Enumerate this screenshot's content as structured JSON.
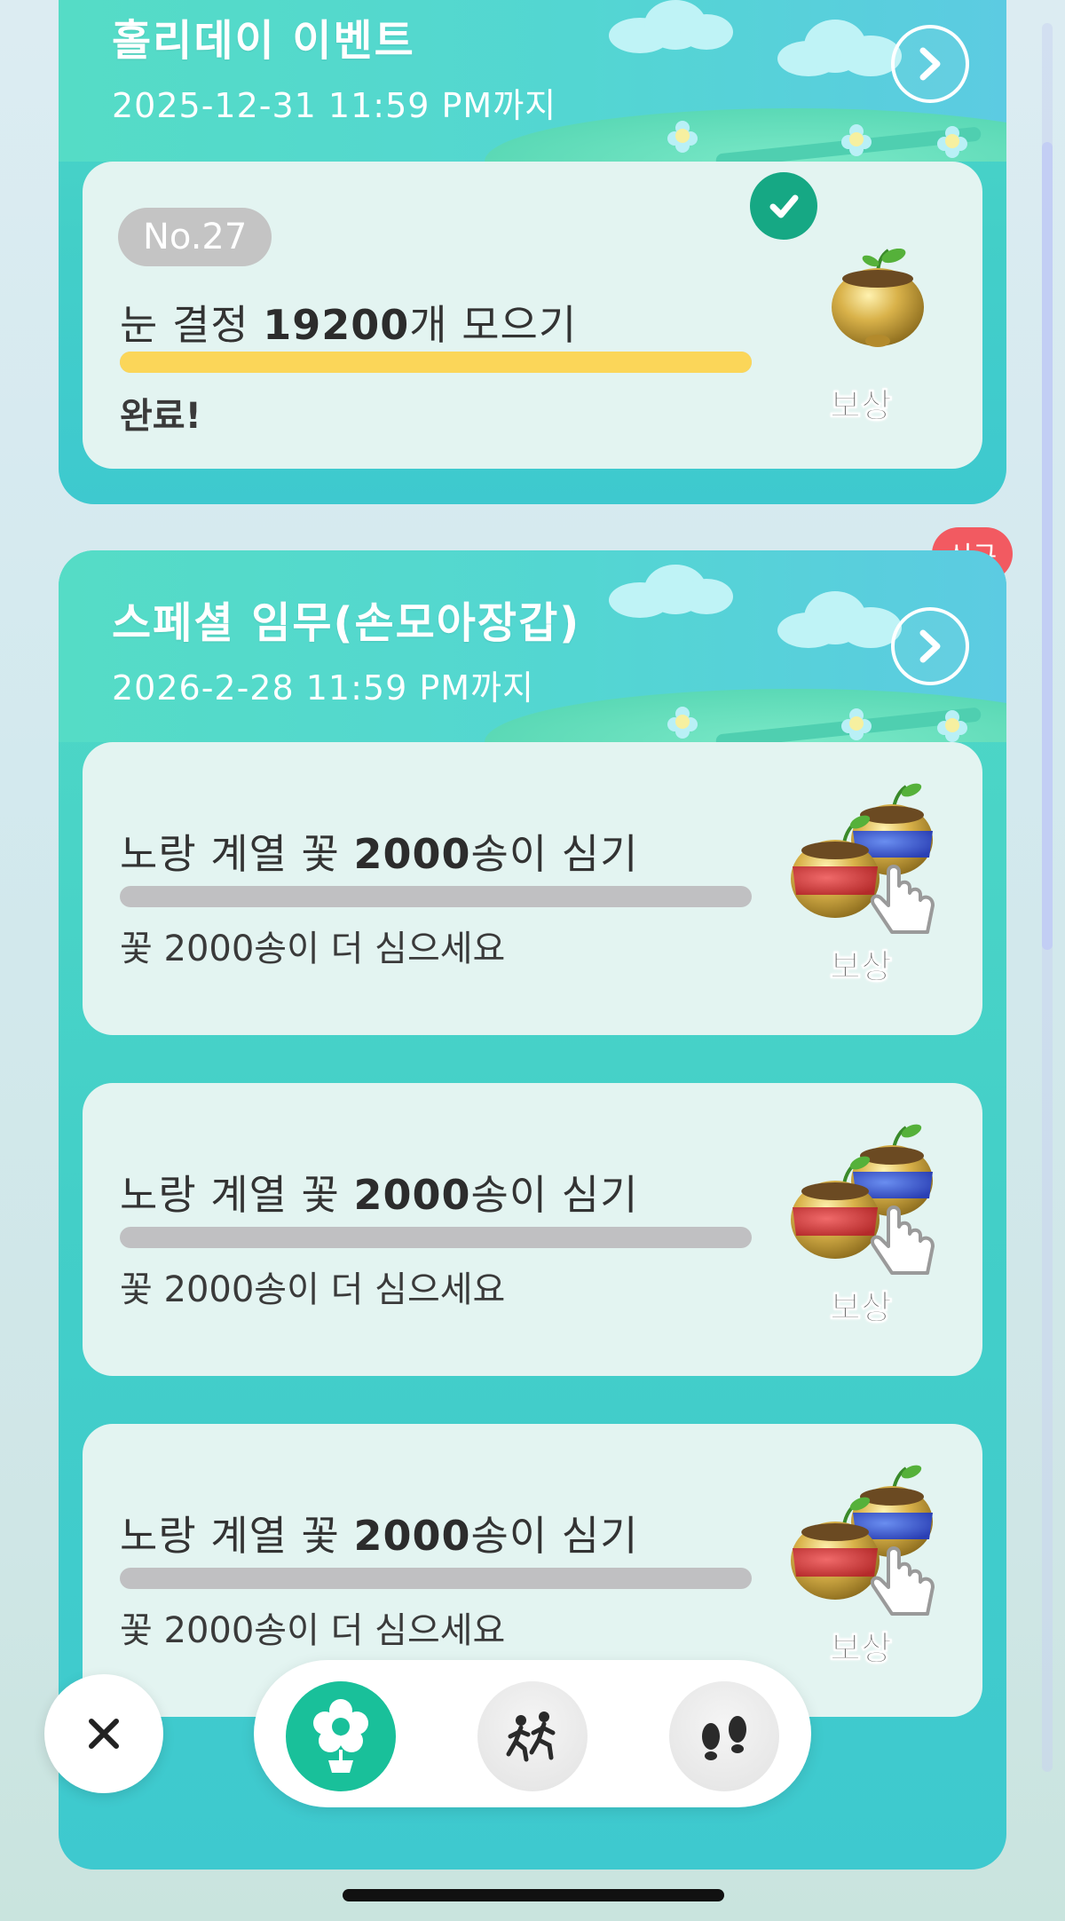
{
  "sections": [
    {
      "title": "홀리데이 이벤트",
      "date": "2025-12-31 11:59 PM까지",
      "cards": [
        {
          "number": "No.27",
          "title_pre": "눈 결정 ",
          "title_bold": "19200",
          "title_post": "개 모으기",
          "progress": 1.0,
          "status": "완료!",
          "reward_label": "보상",
          "completed": true
        }
      ]
    },
    {
      "title": "스페셜 임무(손모아장갑)",
      "date": "2026-2-28 11:59 PM까지",
      "badge": "신규",
      "cards": [
        {
          "title_pre": "노랑 계열 꽃 ",
          "title_bold": "2000",
          "title_post": "송이 심기",
          "progress": 0.0,
          "status": "꽃 2000송이 더 심으세요",
          "reward_label": "보상"
        },
        {
          "title_pre": "노랑 계열 꽃 ",
          "title_bold": "2000",
          "title_post": "송이 심기",
          "progress": 0.0,
          "status": "꽃 2000송이 더 심으세요",
          "reward_label": "보상"
        },
        {
          "title_pre": "노랑 계열 꽃 ",
          "title_bold": "2000",
          "title_post": "송이 심기",
          "progress": 0.0,
          "status": "꽃 2000송이 더 심으세요",
          "reward_label": "보상"
        }
      ]
    }
  ],
  "bottom_nav": {
    "close_icon": "close-icon",
    "items": [
      {
        "icon": "flower-balloon-icon",
        "active": true
      },
      {
        "icon": "running-people-icon",
        "active": false
      },
      {
        "icon": "footprints-icon",
        "active": false
      }
    ]
  },
  "colors": {
    "accent_green": "#19c09a",
    "progress_yellow": "#fbd659",
    "badge_red": "#f25a61",
    "section_teal": "#43cfc8"
  }
}
